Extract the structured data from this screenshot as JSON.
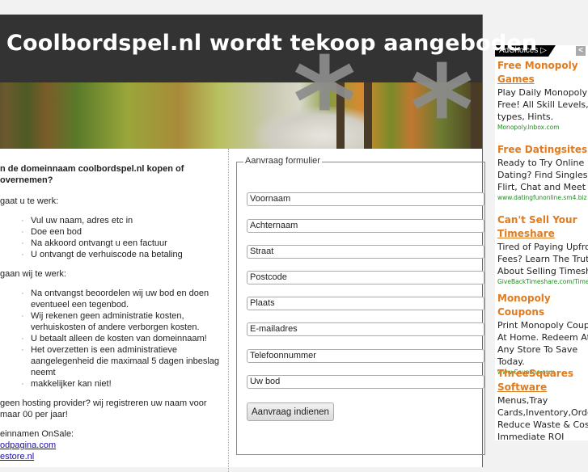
{
  "header": {
    "title": "Coolbordspel.nl wordt tekoop aangeboden"
  },
  "banner": {
    "decoration_glyph": "*"
  },
  "intro": {
    "question": "n de domeinnaam coolbordspel.nl kopen of overnemen?",
    "you_steps_heading": "gaat u te werk:",
    "you_steps": [
      "Vul uw naam, adres etc in",
      "Doe een bod",
      "Na akkoord ontvangt u een factuur",
      "U ontvangt de verhuiscode na betaling"
    ],
    "we_steps_heading": "gaan wij te werk:",
    "we_steps": [
      "Na ontvangst beoordelen wij uw bod en doen eventueel een tegenbod.",
      "Wij rekenen geen administratie kosten, verhuiskosten of andere verborgen kosten.",
      "U betaalt alleen de kosten van domeinnaam!",
      "Het overzetten is een administratieve aangelegenheid die maximaal 5 dagen inbeslag neemt",
      "makkelijker kan niet!"
    ],
    "hosting_note": "geen hosting provider? wij registreren uw naam voor maar 00 per jaar!",
    "onsale_heading": "einnamen OnSale:",
    "onsale_links": [
      "odpagina.com",
      "estore.nl"
    ]
  },
  "form": {
    "legend": "Aanvraag formulier",
    "fields": [
      {
        "value": "Voornaam"
      },
      {
        "value": "Achternaam"
      },
      {
        "value": "Straat"
      },
      {
        "value": "Postcode"
      },
      {
        "value": "Plaats"
      },
      {
        "value": "E-mailadres"
      },
      {
        "value": "Telefoonnummer"
      },
      {
        "value": "Uw bod"
      }
    ],
    "submit_label": "Aanvraag indienen"
  },
  "ads": {
    "adchoices_label": "AdChoices ▷",
    "close_glyph": "<",
    "items": [
      {
        "title1": "Free Monopoly",
        "title2": "Games",
        "body": [
          "Play Daily Monopoly, A",
          "Free! All Skill Levels, A",
          "types, Hints."
        ],
        "url": "Monopoly.Inbox.com"
      },
      {
        "title1": "Free Datingsites",
        "title2": "",
        "body": [
          "Ready to Try Online",
          "Dating? Find Singles to",
          "Flirt, Chat and Meet"
        ],
        "url": "www.datingfunonline.sm4.biz"
      },
      {
        "title1": "Can't Sell Your",
        "title2": "Timeshare",
        "body": [
          "Tired of Paying Upfront",
          "Fees? Learn The Truth",
          "About Selling Timeshar"
        ],
        "url": "GiveBackTimeshare.com/Time"
      },
      {
        "title1": "Monopoly Coupons",
        "title2": "",
        "body": [
          "Print Monopoly Coupon",
          "At Home. Redeem At",
          "Any Store To Save",
          "Today."
        ],
        "url": "www.Coupons.com"
      },
      {
        "title1": "ThreeSquares",
        "title2": "Software",
        "body": [
          "Menus,Tray",
          "Cards,Inventory,Orderin",
          "Reduce Waste & Cost -",
          "Immediate ROI"
        ],
        "url": ""
      }
    ]
  },
  "colors": {
    "header_bg": "#333333",
    "ad_title": "#e07b20",
    "ad_url": "#228b22",
    "link": "#1a0dab"
  }
}
